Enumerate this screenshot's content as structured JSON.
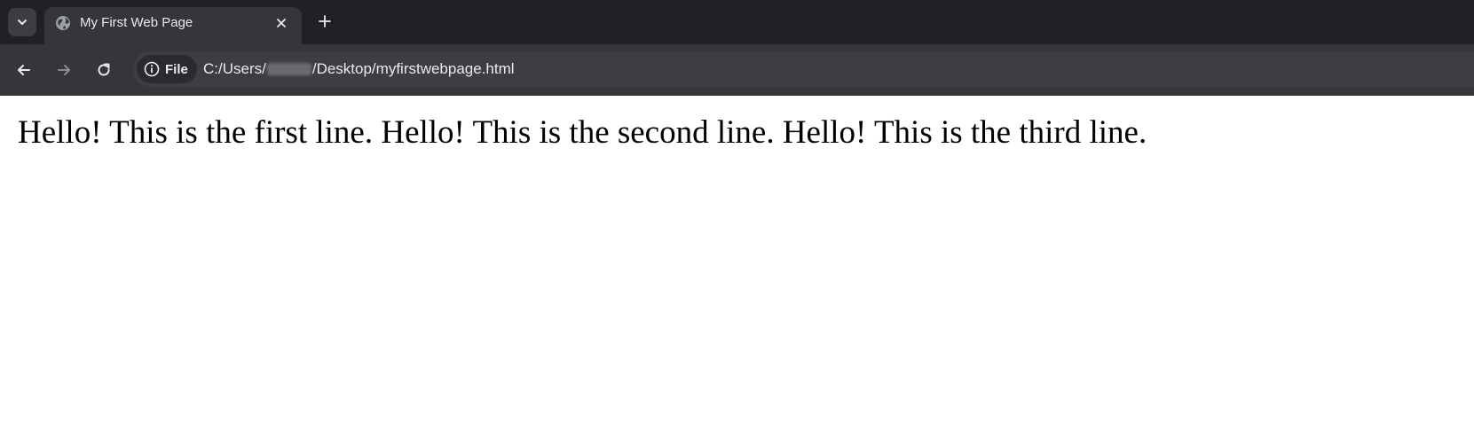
{
  "tab": {
    "title": "My First Web Page",
    "favicon": "globe-icon",
    "close_icon": "close-icon"
  },
  "tabstrip": {
    "tab_search_icon": "chevron-down-icon",
    "new_tab_icon": "plus-icon"
  },
  "toolbar": {
    "back_icon": "arrow-left-icon",
    "forward_icon": "arrow-right-icon",
    "reload_icon": "reload-icon"
  },
  "omnibox": {
    "site_info_icon": "info-icon",
    "site_info_label": "File",
    "url_prefix": "C:/Users/",
    "url_suffix": "/Desktop/myfirstwebpage.html"
  },
  "page": {
    "body_text": "Hello! This is the first line. Hello! This is the second line. Hello! This is the third line."
  },
  "colors": {
    "tabstrip_bg": "#202124",
    "toolbar_bg": "#35363a",
    "omnibox_bg": "#3d3e42",
    "text_light": "#e8eaed",
    "page_bg": "#ffffff",
    "page_text": "#000000"
  }
}
